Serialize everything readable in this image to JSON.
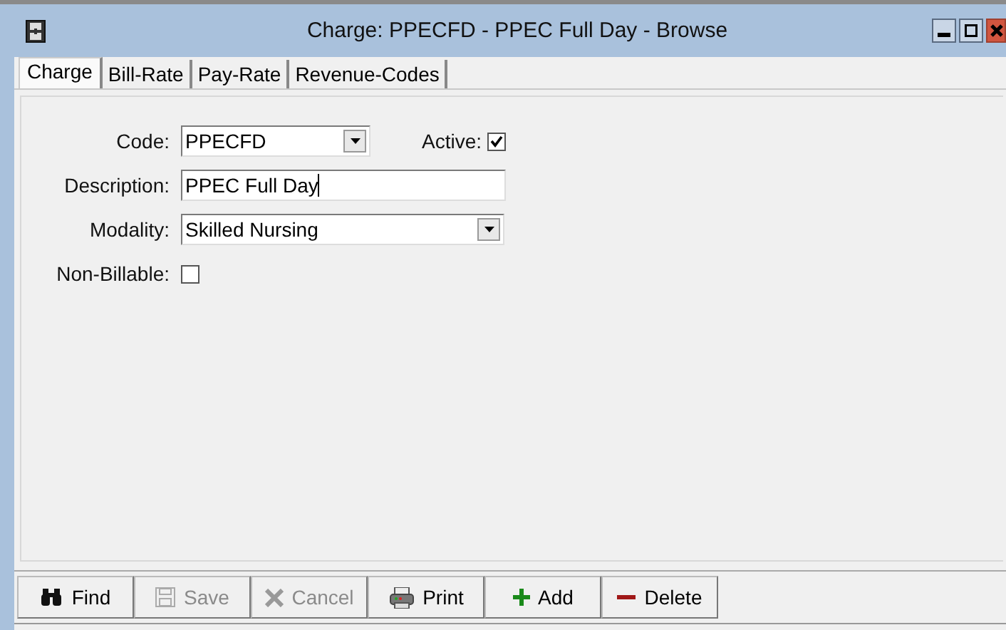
{
  "window": {
    "title": "Charge: PPECFD - PPEC Full Day - Browse"
  },
  "tabs": [
    {
      "label": "Charge",
      "selected": true
    },
    {
      "label": "Bill-Rate",
      "selected": false
    },
    {
      "label": "Pay-Rate",
      "selected": false
    },
    {
      "label": "Revenue-Codes",
      "selected": false
    }
  ],
  "form": {
    "code": {
      "label": "Code:",
      "value": "PPECFD"
    },
    "active": {
      "label": "Active:",
      "checked": true
    },
    "description": {
      "label": "Description:",
      "value": "PPEC Full Day"
    },
    "modality": {
      "label": "Modality:",
      "value": "Skilled Nursing"
    },
    "non_billable": {
      "label": "Non-Billable:",
      "checked": false
    }
  },
  "toolbar": [
    {
      "kind": "find",
      "label": "Find",
      "disabled": false
    },
    {
      "kind": "save",
      "label": "Save",
      "disabled": true
    },
    {
      "kind": "cancel",
      "label": "Cancel",
      "disabled": true
    },
    {
      "kind": "print",
      "label": "Print",
      "disabled": false
    },
    {
      "kind": "add",
      "label": "Add",
      "disabled": false
    },
    {
      "kind": "delete",
      "label": "Delete",
      "disabled": false
    }
  ]
}
